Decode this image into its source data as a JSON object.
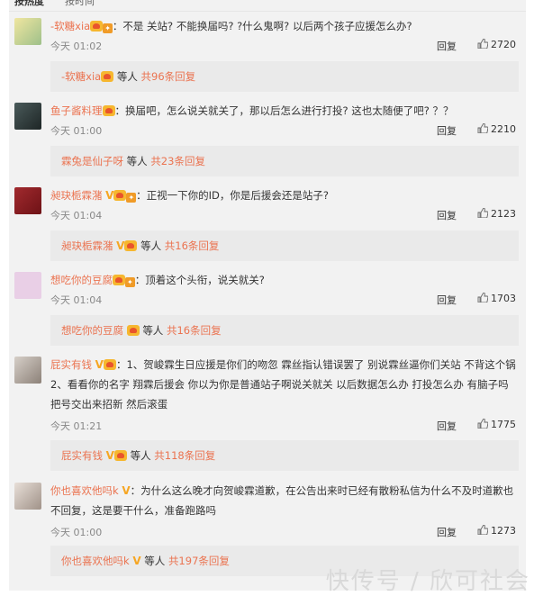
{
  "sort": {
    "hot": "按热度",
    "time": "按时间"
  },
  "colors": {
    "accent": "#eb7350",
    "text": "#333333",
    "muted": "#888888",
    "panel": "#f2f2f2"
  },
  "comments": [
    {
      "user": "-软糖xia",
      "text": "：不是 关站? 不能换届吗? ?什么鬼啊? 以后两个孩子应援怎么办?",
      "time": "今天 01:02",
      "reply": "回复",
      "likes": "2720",
      "sub_user": "-软糖xia",
      "sub_mid": "等人",
      "sub_count": "共96条回复",
      "avatar_color": "#c9d9a8"
    },
    {
      "user": "鱼子酱料理",
      "text": "：换届吧，怎么说关就关了，那以后怎么进行打投? 这也太随便了吧? ？？",
      "time": "今天 01:00",
      "reply": "回复",
      "likes": "2210",
      "sub_user": "霖兔是仙子呀",
      "sub_mid": "等人",
      "sub_count": "共23条回复",
      "avatar_color": "#2f3a3a"
    },
    {
      "user": "昶玦栀霖潴",
      "text": "：正视一下你的ID，你是后援会还是站子?",
      "time": "今天 01:04",
      "reply": "回复",
      "likes": "2123",
      "sub_user": "昶玦栀霖潴",
      "sub_mid": "等人",
      "sub_count": "共16条回复",
      "avatar_color": "#8b1e22"
    },
    {
      "user": "想吃你的豆腐",
      "text": "：顶着这个头衔，说关就关?",
      "time": "今天 01:04",
      "reply": "回复",
      "likes": "1703",
      "sub_user": "想吃你的豆腐",
      "sub_mid": "等人",
      "sub_count": "共16条回复",
      "avatar_color": "#e9cfe6"
    },
    {
      "user": "屁实有钱",
      "text": "：1、贺峻霖生日应援是你们的吻忽 霖丝指认错误罢了 别说霖丝逼你们关站 不背这个锅 2、看看你的名字 翔霖后援会 你以为你是普通站子啊说关就关 以后数据怎么办 打投怎么办 有脑子吗 把号交出来招新 然后滚蛋",
      "time": "今天 01:21",
      "reply": "回复",
      "likes": "1775",
      "sub_user": "屁实有钱",
      "sub_mid": "等人",
      "sub_count": "共118条回复",
      "avatar_color": "#b9b2aa"
    },
    {
      "user": "你也喜欢他吗k",
      "text": "：为什么这么晚才向贺峻霖道歉，在公告出来时已经有散粉私信为什么不及时道歉也不回复，这是要干什么，准备跑路吗",
      "time": "今天 01:00",
      "reply": "回复",
      "likes": "1273",
      "sub_user": "你也喜欢他吗k",
      "sub_mid": "等人",
      "sub_count": "共197条回复",
      "avatar_color": "#cfc6bf"
    }
  ],
  "watermark": "快传号 / 欣可社会"
}
